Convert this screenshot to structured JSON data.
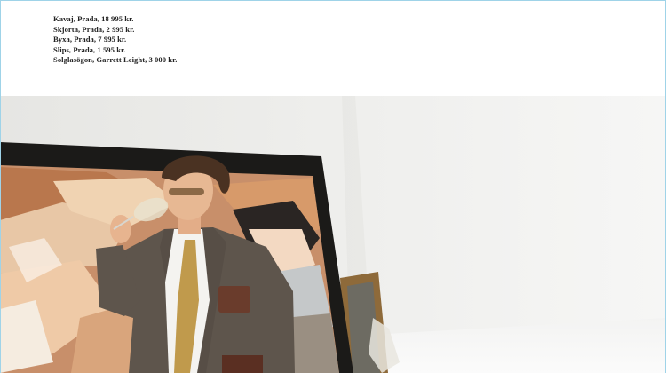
{
  "credits": [
    "Kavaj, Prada, 18 995 kr.",
    "Skjorta, Prada, 2 995 kr.",
    "Byxa, Prada,  7 995 kr.",
    "Slips, Prada, 1 595 kr.",
    "Solglasögon, Garrett Leight, 3 000 kr."
  ],
  "colors": {
    "wall": "#ededeb",
    "frame": "#1b1a18",
    "painting_base": "#c88f6a",
    "jacket": "#5e554c",
    "tie": "#c09a4c",
    "shirt": "#f4f3f0"
  },
  "icons": {
    "photo": "fashion-photograph"
  }
}
